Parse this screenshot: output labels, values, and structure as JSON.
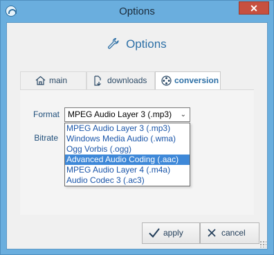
{
  "window": {
    "title": "Options",
    "close_glyph": "✕"
  },
  "header": {
    "title": "Options",
    "icon": "wrench-icon"
  },
  "tabs": [
    {
      "label": "main",
      "icon": "house-icon",
      "active": false
    },
    {
      "label": "downloads",
      "icon": "download-icon",
      "active": false
    },
    {
      "label": "conversion",
      "icon": "film-reel-icon",
      "active": true
    }
  ],
  "form": {
    "format_label": "Format",
    "bitrate_label": "Bitrate",
    "format_value": "MPEG Audio Layer 3 (.mp3)",
    "format_options": [
      "MPEG Audio Layer 3 (.mp3)",
      "Windows Media Audio (.wma)",
      "Ogg Vorbis (.ogg)",
      "Advanced Audio Coding (.aac)",
      "MPEG Audio Layer 4 (.m4a)",
      "Audio Codec 3 (.ac3)"
    ],
    "highlighted_option_index": 3
  },
  "buttons": {
    "apply_label": "apply",
    "cancel_label": "cancel"
  },
  "colors": {
    "accent": "#2c6fa6",
    "selection": "#3e88d8",
    "window_frame": "#6aaede",
    "close_button": "#c7503f"
  }
}
